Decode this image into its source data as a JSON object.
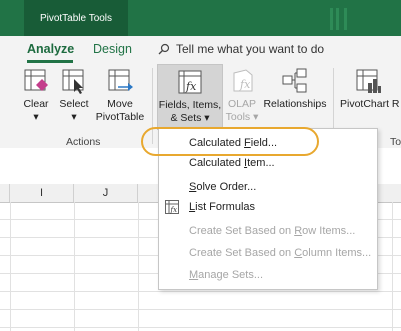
{
  "context_tab": {
    "label": "PivotTable Tools"
  },
  "tabs": [
    {
      "label": "Analyze",
      "active": true
    },
    {
      "label": "Design",
      "active": false
    }
  ],
  "tell_me": {
    "label": "Tell me what you want to do",
    "icon": "search-icon"
  },
  "ribbon": {
    "actions_group_label": "Actions",
    "buttons": {
      "clear": {
        "label": "Clear",
        "arrow": "▾"
      },
      "select": {
        "label": "Select",
        "arrow": "▾"
      },
      "move": {
        "line1": "Move",
        "line2": "PivotTable"
      },
      "fields": {
        "line1": "Fields, Items,",
        "line2": "& Sets ▾"
      },
      "olap": {
        "line1": "OLAP",
        "line2": "Tools ▾"
      },
      "relationships": {
        "label": "Relationships"
      },
      "pivotchart": {
        "label": "PivotChart R"
      }
    },
    "tools_group_label": "To"
  },
  "columns": [
    "I",
    "J"
  ],
  "menu": {
    "items": [
      {
        "pre": "Calculated ",
        "u": "F",
        "post": "ield...",
        "enabled": true
      },
      {
        "pre": "Calculated ",
        "u": "I",
        "post": "tem...",
        "enabled": true
      },
      {
        "pre": "",
        "u": "S",
        "post": "olve Order...",
        "enabled": true
      },
      {
        "pre": "",
        "u": "L",
        "post": "ist Formulas",
        "enabled": true,
        "icon": "list-formulas-icon"
      },
      {
        "pre": "Create Set Based on ",
        "u": "R",
        "post": "ow Items...",
        "enabled": false
      },
      {
        "pre": "Create Set Based on ",
        "u": "C",
        "post": "olumn Items...",
        "enabled": false
      },
      {
        "pre": "",
        "u": "M",
        "post": "anage Sets...",
        "enabled": false
      }
    ]
  },
  "colors": {
    "excel_green": "#217346",
    "context_green": "#185c37",
    "highlight": "#e8a82f"
  }
}
